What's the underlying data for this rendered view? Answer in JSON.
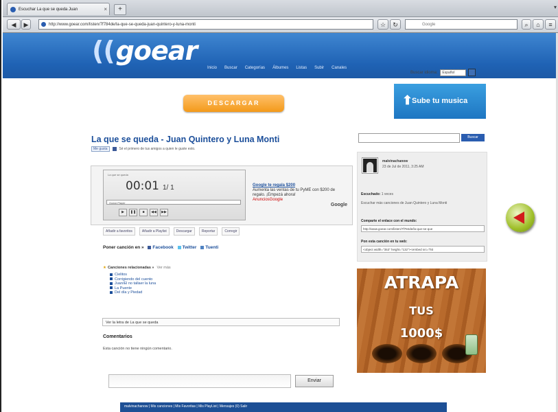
{
  "browser": {
    "tab_title": "Escuchar La que se queda Juan",
    "new_tab": "+",
    "url": "http://www.goear.com/listen/7f784de/la-que-se-queda-juan-quintero-y-luna-monti",
    "search_placeholder": "Google"
  },
  "header": {
    "logo_text": "goear",
    "nav": [
      "Inicio",
      "Buscar",
      "Categorías",
      "Álbumes",
      "Listas",
      "Subir",
      "Canales"
    ],
    "search_label": "Buscar idioma:",
    "lang": "Español"
  },
  "promo": {
    "download": "DESCARGAR",
    "upload": "Sube tu musica"
  },
  "song": {
    "title": "La que se queda - Juan Quintero y Luna Monti",
    "like": "Me gusta",
    "like_text": "Sé el primero de tus amigos a quien le guste esto."
  },
  "player": {
    "label": "La que se queda",
    "time": "00:01",
    "track": "1/ 1",
    "bar_text": "Goear Player"
  },
  "ad": {
    "headline": "Google te regala $200",
    "body": "Aumenta las ventas de tu PyME con $200 de regalo. ¡Empezá ahora!",
    "link": "AnunciosGoogle",
    "brand": "Google"
  },
  "actions": [
    "Añadir a favoritos",
    "Añadir a Playlist",
    "Descargar",
    "Reportar",
    "Corregir"
  ],
  "share": {
    "label": "Poner canción en »",
    "targets": [
      "Facebook",
      "Twitter",
      "Tuenti"
    ]
  },
  "related": {
    "header": "Canciones relacionadas »",
    "more": "Ver más",
    "items": [
      "Cielitos",
      "Corrigiendo del cuento",
      "Juan/El no tallaer la luna",
      "La Puente",
      "Del día y Piedad"
    ]
  },
  "lyrics_label": "Ver la letra de La que se queda",
  "comments": {
    "header": "Comentarios",
    "empty": "Esta canción no tiene ningún comentario.",
    "send": "Enviar"
  },
  "footer": "malvinachanow | Mis canciones | Mis Favoritas | Mis PlayList | Mensajes (0) Salir",
  "sidebar": {
    "search_button": "Buscar",
    "user": "malvinachanow",
    "date": "23 de Jul de 2011, 3:25 AM",
    "listened_label": "Escuchado:",
    "listened_value": "1 veces",
    "more_text": "Escuchar más canciones de Juan Quintero y Luna Monti",
    "share_link_label": "Comparte el enlace con el mundo:",
    "share_link_value": "http://www.goear.com/listen/7f784de/la-que-se-que",
    "embed_label": "Pon esta canción en tu web:",
    "embed_value": "<object width=\"353\" height=\"132\"><embed src=\"htt"
  },
  "banner": {
    "line1": "ATRAPA",
    "line2": "TUS",
    "line3": "1000$"
  }
}
